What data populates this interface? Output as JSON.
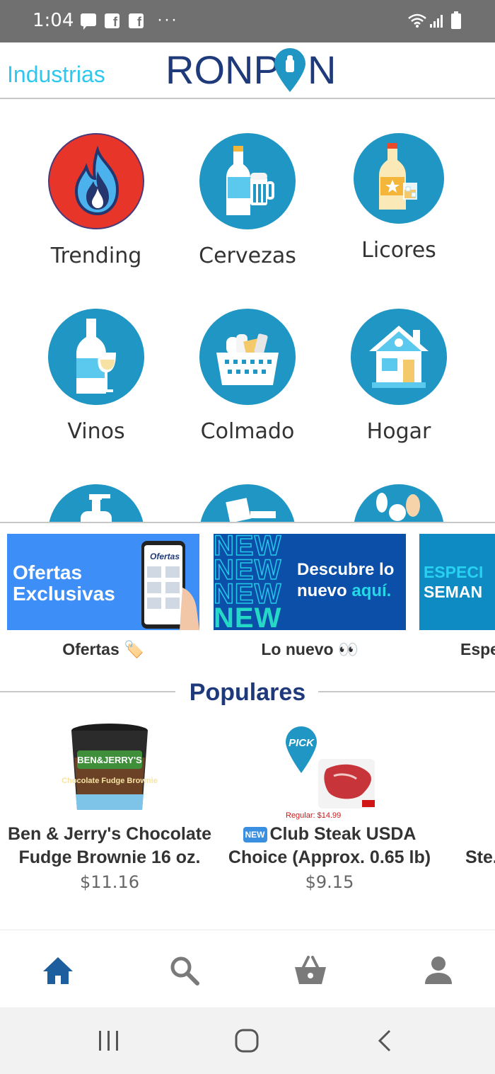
{
  "status_bar": {
    "time": "1:04",
    "more_dots": "···",
    "fb_glyph": "f"
  },
  "header": {
    "industrias_label": "Industrias",
    "logo_text_left": "RONP",
    "logo_text_right": "N",
    "logo_full": "RONPON"
  },
  "categories": [
    {
      "label": "Trending",
      "icon": "flame-icon"
    },
    {
      "label": "Cervezas",
      "icon": "beer-icon"
    },
    {
      "label": "Licores",
      "icon": "liquor-icon"
    },
    {
      "label": "Vinos",
      "icon": "wine-icon"
    },
    {
      "label": "Colmado",
      "icon": "basket-icon"
    },
    {
      "label": "Hogar",
      "icon": "house-icon"
    }
  ],
  "banners": [
    {
      "label": "Ofertas 🏷️",
      "text_line1": "Ofertas",
      "text_line2": "Exclusivas",
      "phone_text": "Ofertas"
    },
    {
      "label": "Lo nuevo 👀",
      "new_word": "NEW",
      "desc_line1": "Descubre lo",
      "desc_line2a": "nuevo ",
      "desc_line2b": "aquí."
    },
    {
      "label": "Espe",
      "text_line1": "ESPECI",
      "text_line2": "SEMAN"
    }
  ],
  "populares": {
    "title": "Populares",
    "products": [
      {
        "name": "Ben & Jerry's Chocolate Fudge Brownie 16 oz.",
        "price": "$11.16",
        "img_brand": "BEN&JERRY'S",
        "img_flavor": "Chocolate Fudge Brownie"
      },
      {
        "name": "Club Steak USDA Choice (Approx. 0.65 lb)",
        "price": "$9.15",
        "regular": "Regular: $14.99",
        "badge": "NEW",
        "pick_label": "PICK"
      },
      {
        "name": "Ste... (",
        "price": ""
      }
    ]
  },
  "bottom_nav": {
    "items": [
      "home-icon",
      "search-icon",
      "cart-icon",
      "user-icon"
    ],
    "active": "home-icon"
  },
  "colors": {
    "accent": "#2ec7ee",
    "brand": "#1f3a7a",
    "icon_circle": "#1f96c3",
    "trending_circle": "#e8352a",
    "nav_active": "#1d5f9e"
  }
}
